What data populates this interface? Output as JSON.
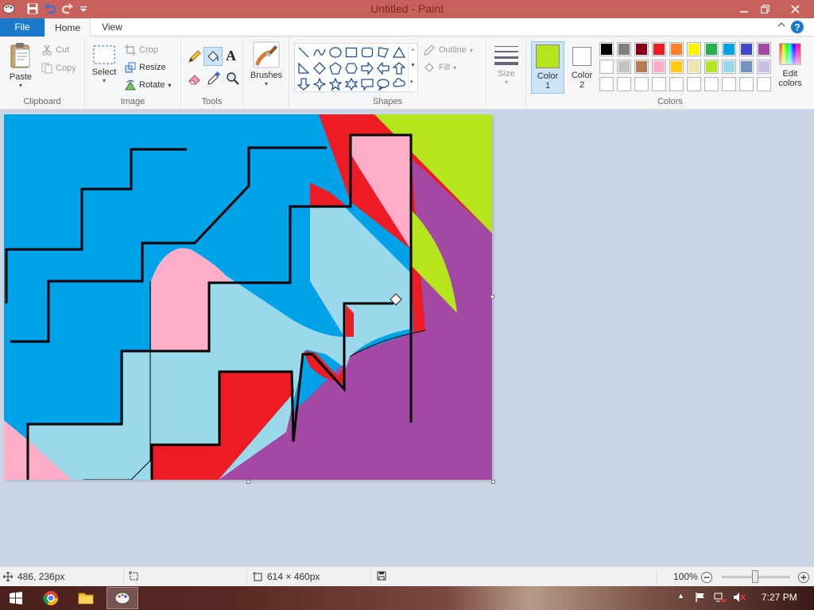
{
  "window": {
    "title": "Untitled - Paint"
  },
  "tabs": {
    "file": "File",
    "home": "Home",
    "view": "View"
  },
  "help": "?",
  "clipboard": {
    "label": "Clipboard",
    "paste": "Paste",
    "cut": "Cut",
    "copy": "Copy"
  },
  "image": {
    "label": "Image",
    "select": "Select",
    "crop": "Crop",
    "resize": "Resize",
    "rotate": "Rotate"
  },
  "tools": {
    "label": "Tools",
    "text_glyph": "A"
  },
  "brushes": {
    "label": "Brushes"
  },
  "shapes": {
    "label": "Shapes",
    "outline": "Outline",
    "fill": "Fill"
  },
  "size": {
    "label": "Size"
  },
  "colors": {
    "label": "Colors",
    "color1_line1": "Color",
    "color1_line2": "1",
    "color2_line1": "Color",
    "color2_line2": "2",
    "edit_line1": "Edit",
    "edit_line2": "colors",
    "color1_value": "#b5e61d",
    "color2_value": "#ffffff",
    "palette_row1": [
      "#000000",
      "#7f7f7f",
      "#880015",
      "#ed1c24",
      "#ff7f27",
      "#fff200",
      "#22b14c",
      "#00a2e8",
      "#3f48cc",
      "#a349a4"
    ],
    "palette_row2": [
      "#ffffff",
      "#c3c3c3",
      "#b97a57",
      "#ffaec9",
      "#ffc90e",
      "#efe4b0",
      "#b5e61d",
      "#99d9ea",
      "#7092be",
      "#c8bfe7"
    ]
  },
  "status": {
    "cursor_pos": "486, 236px",
    "canvas_size": "614 × 460px",
    "zoom": "100%"
  },
  "taskbar": {
    "time": "7:27 PM"
  },
  "painting": {
    "blue": "#00a2e8",
    "light_blue": "#99d9ea",
    "pink": "#ffaec9",
    "red": "#ed1c24",
    "purple": "#a349a4",
    "lime": "#b5e61d",
    "black": "#000000"
  }
}
